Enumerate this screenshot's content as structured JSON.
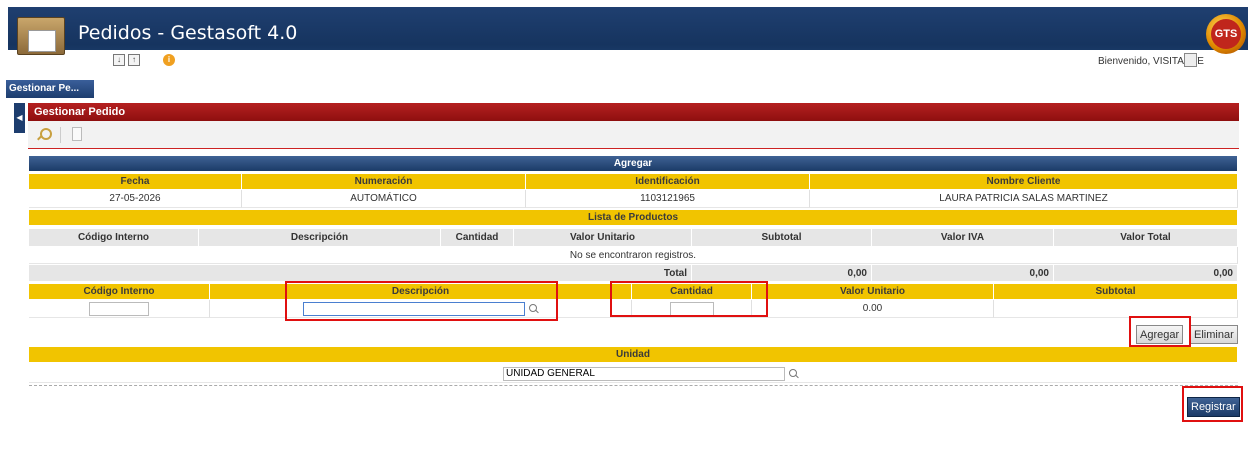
{
  "app": {
    "title": "Pedidos - Gestasoft 4.0",
    "badge": "GTS",
    "welcome": "Bienvenido, VISITANTE"
  },
  "icons": {
    "logo": "package-logo-icon",
    "download": "download-icon",
    "upload": "upload-icon",
    "info": "info-icon",
    "logout": "logout-icon",
    "search": "search-icon",
    "document": "document-icon",
    "collapse": "collapse-arrow-icon"
  },
  "module_tab": "Gestionar Pe...",
  "panel_title": "Gestionar Pedido",
  "section_title": "Agregar",
  "order": {
    "headers": [
      "Fecha",
      "Numeración",
      "Identificación",
      "Nombre Cliente"
    ],
    "values": [
      "27-05-2026",
      "AUTOMÁTICO",
      "1103121965",
      "LAURA PATRICIA SALAS MARTINEZ"
    ]
  },
  "products": {
    "title": "Lista de Productos",
    "headers": [
      "Código Interno",
      "Descripción",
      "Cantidad",
      "Valor Unitario",
      "Subtotal",
      "Valor IVA",
      "Valor Total"
    ],
    "empty_message": "No se encontraron registros.",
    "total_label": "Total",
    "totals": [
      "0,00",
      "0,00",
      "0,00"
    ]
  },
  "entry": {
    "headers": [
      "Código Interno",
      "Descripción",
      "Cantidad",
      "Valor Unitario",
      "Subtotal"
    ],
    "codigo_value": "",
    "descripcion_value": "",
    "cantidad_value": "",
    "valor_unitario": "0.00",
    "subtotal": ""
  },
  "buttons": {
    "agregar": "Agregar",
    "eliminar": "Eliminar",
    "registrar": "Registrar"
  },
  "unidad": {
    "header": "Unidad",
    "value": "UNIDAD GENERAL"
  },
  "colors": {
    "header_blue": "#1b3b68",
    "gold": "#f1c400",
    "panel_red": "#a01818",
    "highlight": "#e01010"
  }
}
